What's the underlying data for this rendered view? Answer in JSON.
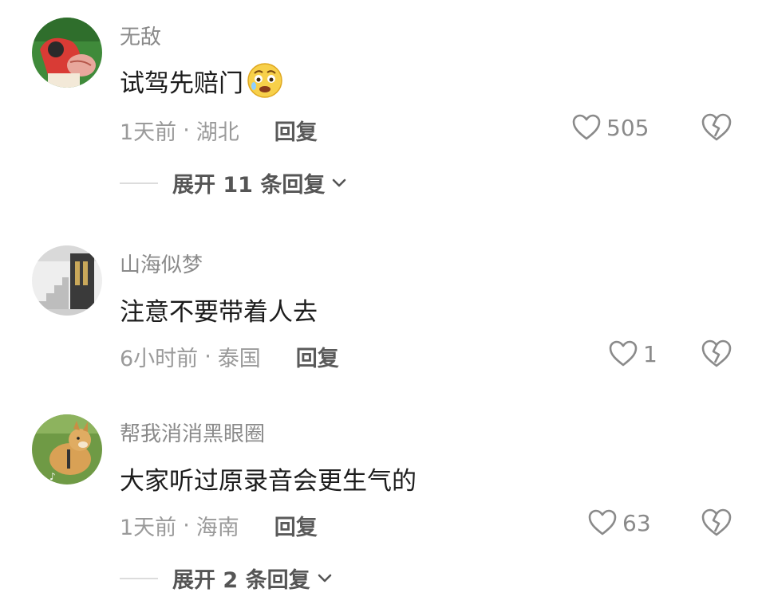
{
  "comments": [
    {
      "username": "无敌",
      "text": "试驾先赔门",
      "emoji": "anxious-face-emoji",
      "time": "1天前",
      "location": "湖北",
      "separator": "·",
      "reply_label": "回复",
      "likes": "505",
      "expand_label": "展开 11 条回复"
    },
    {
      "username": "山海似梦",
      "text": "注意不要带着人去",
      "time": "6小时前",
      "location": "泰国",
      "separator": "·",
      "reply_label": "回复",
      "likes": "1"
    },
    {
      "username": "帮我消消黑眼圈",
      "text": "大家听过原录音会更生气的",
      "time": "1天前",
      "location": "海南",
      "separator": "·",
      "reply_label": "回复",
      "likes": "63",
      "expand_label": "展开 2 条回复"
    }
  ],
  "icons": {
    "like": "heart-outline-icon",
    "dislike": "broken-heart-icon",
    "expand": "chevron-down-icon"
  },
  "colors": {
    "username": "#8a8a8a",
    "meta": "#9a9a9a",
    "text": "#1c1c1c"
  }
}
